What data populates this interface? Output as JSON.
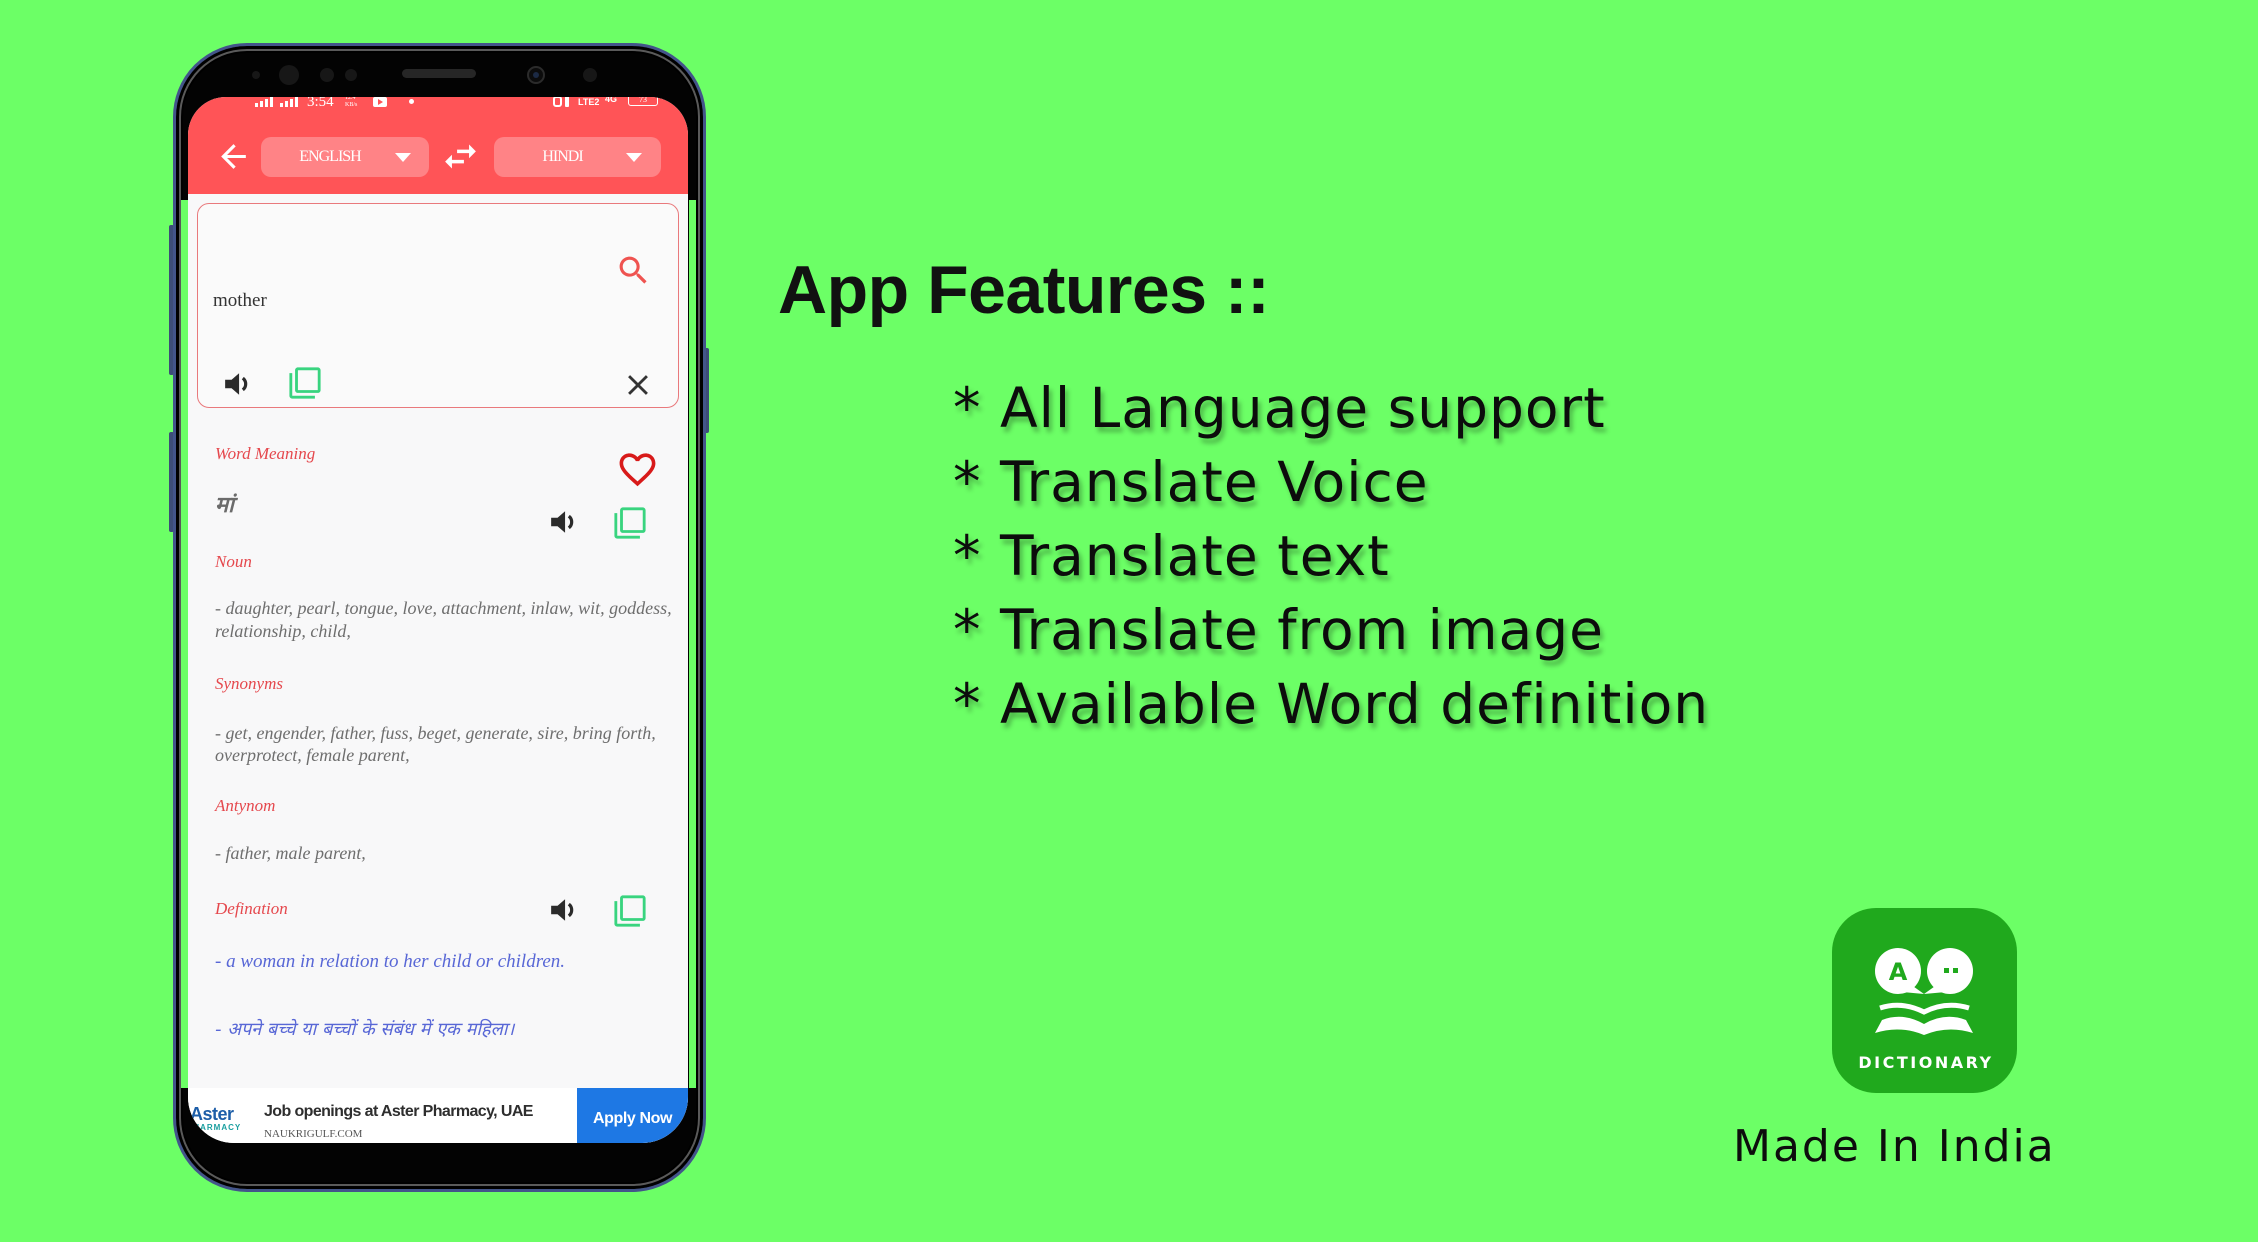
{
  "statusbar": {
    "time": "3:54",
    "network_speed_value": "12.4",
    "network_speed_unit": "KB/s",
    "network_type": "LTE2",
    "data_type": "4G",
    "battery": "73"
  },
  "app": {
    "header": {
      "back_icon": "arrow-back-icon",
      "source_language": "ENGLISH",
      "swap_icon": "swap-horiz-icon",
      "target_language": "HINDI"
    },
    "input": {
      "value": "mother",
      "icons": [
        "search-icon",
        "speaker-icon",
        "copy-icon",
        "close-icon"
      ]
    },
    "result": {
      "word_meaning_label": "Word Meaning",
      "translation": "मां",
      "part_of_speech": "Noun",
      "meanings_lines": [
        "- daughter, pearl, tongue, love, attachment, inlaw, wit, goddess,",
        "relationship, child,"
      ],
      "synonyms_label": "Synonyms",
      "synonyms_lines": [
        "- get, engender, father, fuss, beget, generate, sire, bring forth,",
        "overprotect, female parent,"
      ],
      "antonym_label": "Antynom",
      "antonyms": "- father, male parent,",
      "definition_label": "Defination",
      "definition_en": "- a woman in relation to her child or children.",
      "definition_hi": "- अपने बच्चे या बच्चों के संबंध में एक महिला।"
    },
    "ad": {
      "brand_line1": "Aster",
      "brand_line2": "PHARMACY",
      "headline": "Job openings at Aster Pharmacy, UAE",
      "source": "NAUKRIGULF.COM",
      "cta": "Apply Now"
    }
  },
  "promo": {
    "title": "App Features ::",
    "features": [
      "* All Language support",
      "* Translate Voice",
      "* Translate text",
      "* Translate from image",
      "* Available Word definition"
    ],
    "app_icon_letter": "A",
    "app_icon_label": "DICTIONARY",
    "tagline": "Made In India"
  },
  "colors": {
    "background": "#6cff66",
    "header_red": "#ff5457",
    "label_red": "#e5484d",
    "copy_green": "#39d47f",
    "favorite_red": "#d81a1a",
    "definition_blue": "#5867d6",
    "cta_blue": "#1e78e4",
    "app_icon_green": "#20a91d"
  }
}
